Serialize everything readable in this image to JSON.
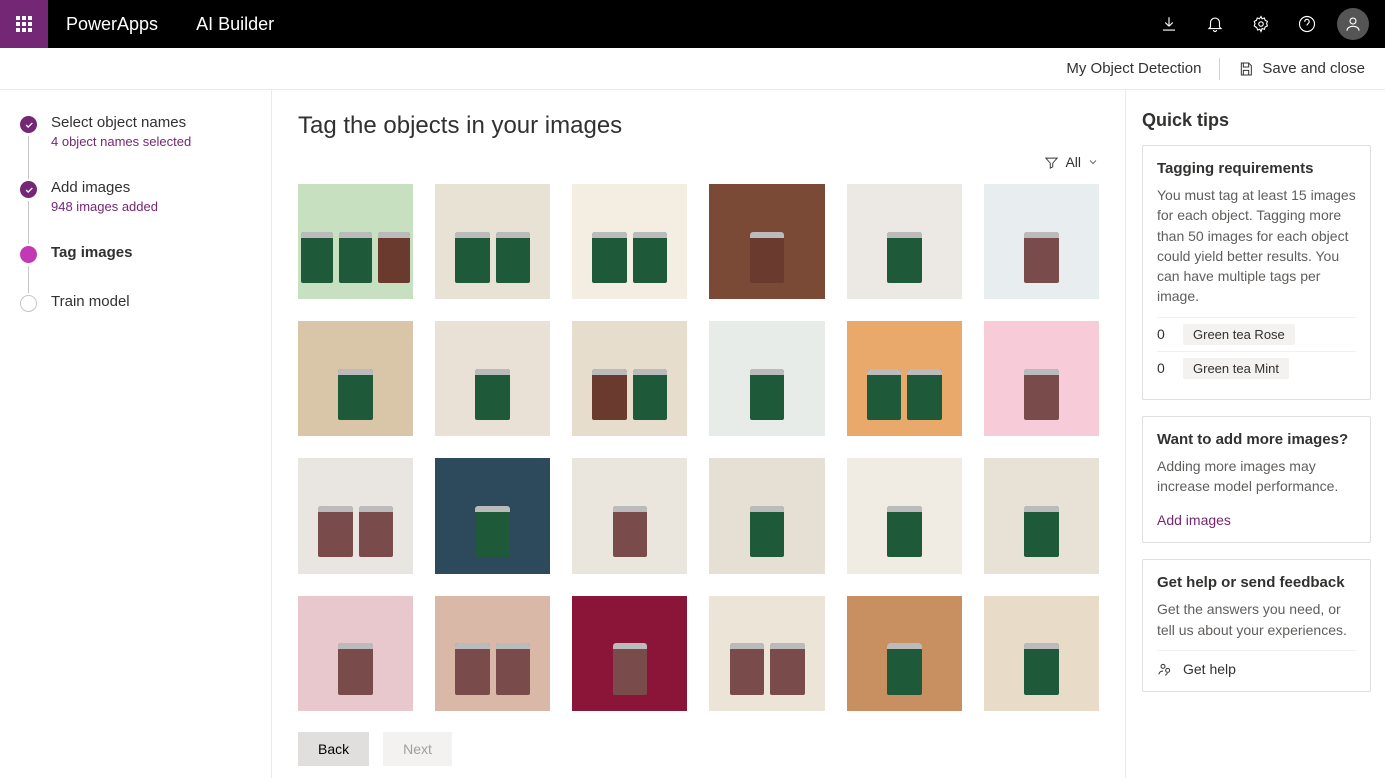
{
  "header": {
    "brand": "PowerApps",
    "app": "AI Builder"
  },
  "subheader": {
    "model_name": "My Object Detection",
    "save_close": "Save and close"
  },
  "stepper": [
    {
      "label": "Select object names",
      "sub": "4 object names selected",
      "state": "done"
    },
    {
      "label": "Add images",
      "sub": "948 images added",
      "state": "done"
    },
    {
      "label": "Tag images",
      "sub": "",
      "state": "active"
    },
    {
      "label": "Train model",
      "sub": "",
      "state": "pending"
    }
  ],
  "main": {
    "title": "Tag the objects in your images",
    "filter_label": "All",
    "thumbnails": [
      {
        "bg": "#c7e0c0",
        "cans": [
          "g",
          "g",
          "b"
        ]
      },
      {
        "bg": "#e8e2d4",
        "cans": [
          "g",
          "g"
        ]
      },
      {
        "bg": "#f4eee2",
        "cans": [
          "g",
          "g"
        ]
      },
      {
        "bg": "#7a4a36",
        "cans": [
          "b"
        ]
      },
      {
        "bg": "#ece8e3",
        "cans": [
          "g"
        ]
      },
      {
        "bg": "#e8edf0",
        "cans": [
          "m"
        ]
      },
      {
        "bg": "#d9c5a8",
        "cans": [
          "g"
        ]
      },
      {
        "bg": "#e9e0d6",
        "cans": [
          "g"
        ]
      },
      {
        "bg": "#e6ddcc",
        "cans": [
          "b",
          "g"
        ]
      },
      {
        "bg": "#e8ece8",
        "cans": [
          "g"
        ]
      },
      {
        "bg": "#e8a96b",
        "cans": [
          "g",
          "g"
        ]
      },
      {
        "bg": "#f7cbd8",
        "cans": [
          "m"
        ]
      },
      {
        "bg": "#e9e5e0",
        "cans": [
          "m",
          "m"
        ]
      },
      {
        "bg": "#2d4a5c",
        "cans": [
          "g"
        ]
      },
      {
        "bg": "#eae5dd",
        "cans": [
          "m"
        ]
      },
      {
        "bg": "#e6e0d4",
        "cans": [
          "g"
        ]
      },
      {
        "bg": "#f0ece4",
        "cans": [
          "g"
        ]
      },
      {
        "bg": "#e8e2d6",
        "cans": [
          "g"
        ]
      },
      {
        "bg": "#e8c8cc",
        "cans": [
          "m"
        ]
      },
      {
        "bg": "#d9b8a8",
        "cans": [
          "m",
          "m"
        ]
      },
      {
        "bg": "#8a1538",
        "cans": [
          "m"
        ]
      },
      {
        "bg": "#ece4d6",
        "cans": [
          "m",
          "m"
        ]
      },
      {
        "bg": "#c89060",
        "cans": [
          "g"
        ]
      },
      {
        "bg": "#e8dcc8",
        "cans": [
          "g"
        ]
      }
    ],
    "back_label": "Back",
    "next_label": "Next"
  },
  "right": {
    "title": "Quick tips",
    "card1": {
      "title": "Tagging requirements",
      "text": "You must tag at least 15 images for each object. Tagging more than 50 images for each object could yield better results. You can have multiple tags per image.",
      "tags": [
        {
          "count": "0",
          "name": "Green tea Rose"
        },
        {
          "count": "0",
          "name": "Green tea Mint"
        }
      ]
    },
    "card2": {
      "title": "Want to add more images?",
      "text": "Adding more images may increase model performance.",
      "link": "Add images"
    },
    "card3": {
      "title": "Get help or send feedback",
      "text": "Get the answers you need, or tell us about your experiences.",
      "link": "Get help"
    }
  }
}
